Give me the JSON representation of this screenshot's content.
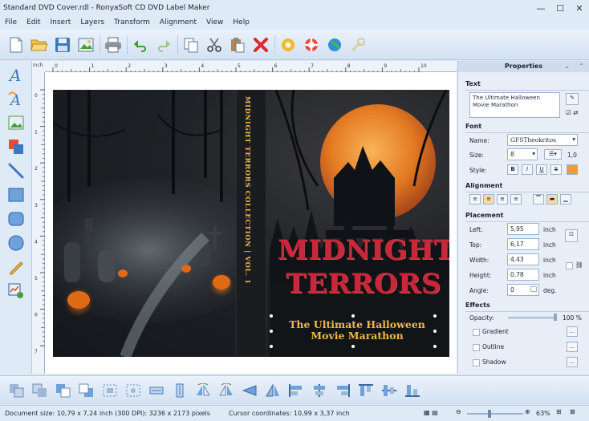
{
  "window": {
    "title": "Standard DVD Cover.rdl - RonyaSoft CD DVD Label Maker",
    "minimize": "—",
    "maximize": "☐",
    "close": "✕"
  },
  "menu": [
    "File",
    "Edit",
    "Insert",
    "Layers",
    "Transform",
    "Alignment",
    "View",
    "Help"
  ],
  "ruler": {
    "unit": "inch",
    "h_ticks": [
      "0",
      "1",
      "2",
      "3",
      "4",
      "5",
      "6",
      "7",
      "8",
      "9",
      "10"
    ],
    "v_ticks": [
      "0",
      "1",
      "2",
      "3",
      "4",
      "5",
      "6",
      "7"
    ]
  },
  "cover": {
    "spine_text": "MIDNIGHT TERRORS COLLECTION | VOL. 1",
    "title_line1": "MIDNIGHT",
    "title_line2": "TERRORS",
    "subtitle_line1": "The Ultimate Halloween",
    "subtitle_line2": "Movie Marathon"
  },
  "properties": {
    "header": "Properties",
    "text_section": "Text",
    "text_value": "The Ultimate Halloween Movie Marathon",
    "font_section": "Font",
    "name_label": "Name:",
    "name_value": "GFSTheokritos",
    "size_label": "Size:",
    "size_value": "8",
    "spacing_value": "1,0",
    "style_label": "Style:",
    "style_buttons": [
      "B",
      "I",
      "U",
      "S"
    ],
    "alignment_section": "Alignment",
    "placement_section": "Placement",
    "left_label": "Left:",
    "left_value": "5,95",
    "top_label": "Top:",
    "top_value": "6,17",
    "width_label": "Width:",
    "width_value": "4,43",
    "height_label": "Height:",
    "height_value": "0,78",
    "angle_label": "Angle:",
    "angle_value": "0",
    "unit": "inch",
    "angle_unit": "deg.",
    "effects_section": "Effects",
    "opacity_label": "Opacity:",
    "opacity_value": "100 %",
    "gradient_label": "Gradient",
    "outline_label": "Outline",
    "shadow_label": "Shadow",
    "more_button": "..."
  },
  "status": {
    "doc_size": "Document size: 10,79 x 7,24 inch (300 DPI): 3236 x 2173 pixels",
    "cursor": "Cursor coordinates: 10,99 x 3,37 inch",
    "zoom": "63%"
  },
  "colors": {
    "accent": "#f29a3a",
    "title_red": "#c8283a",
    "subtitle_gold": "#f0b84a"
  }
}
